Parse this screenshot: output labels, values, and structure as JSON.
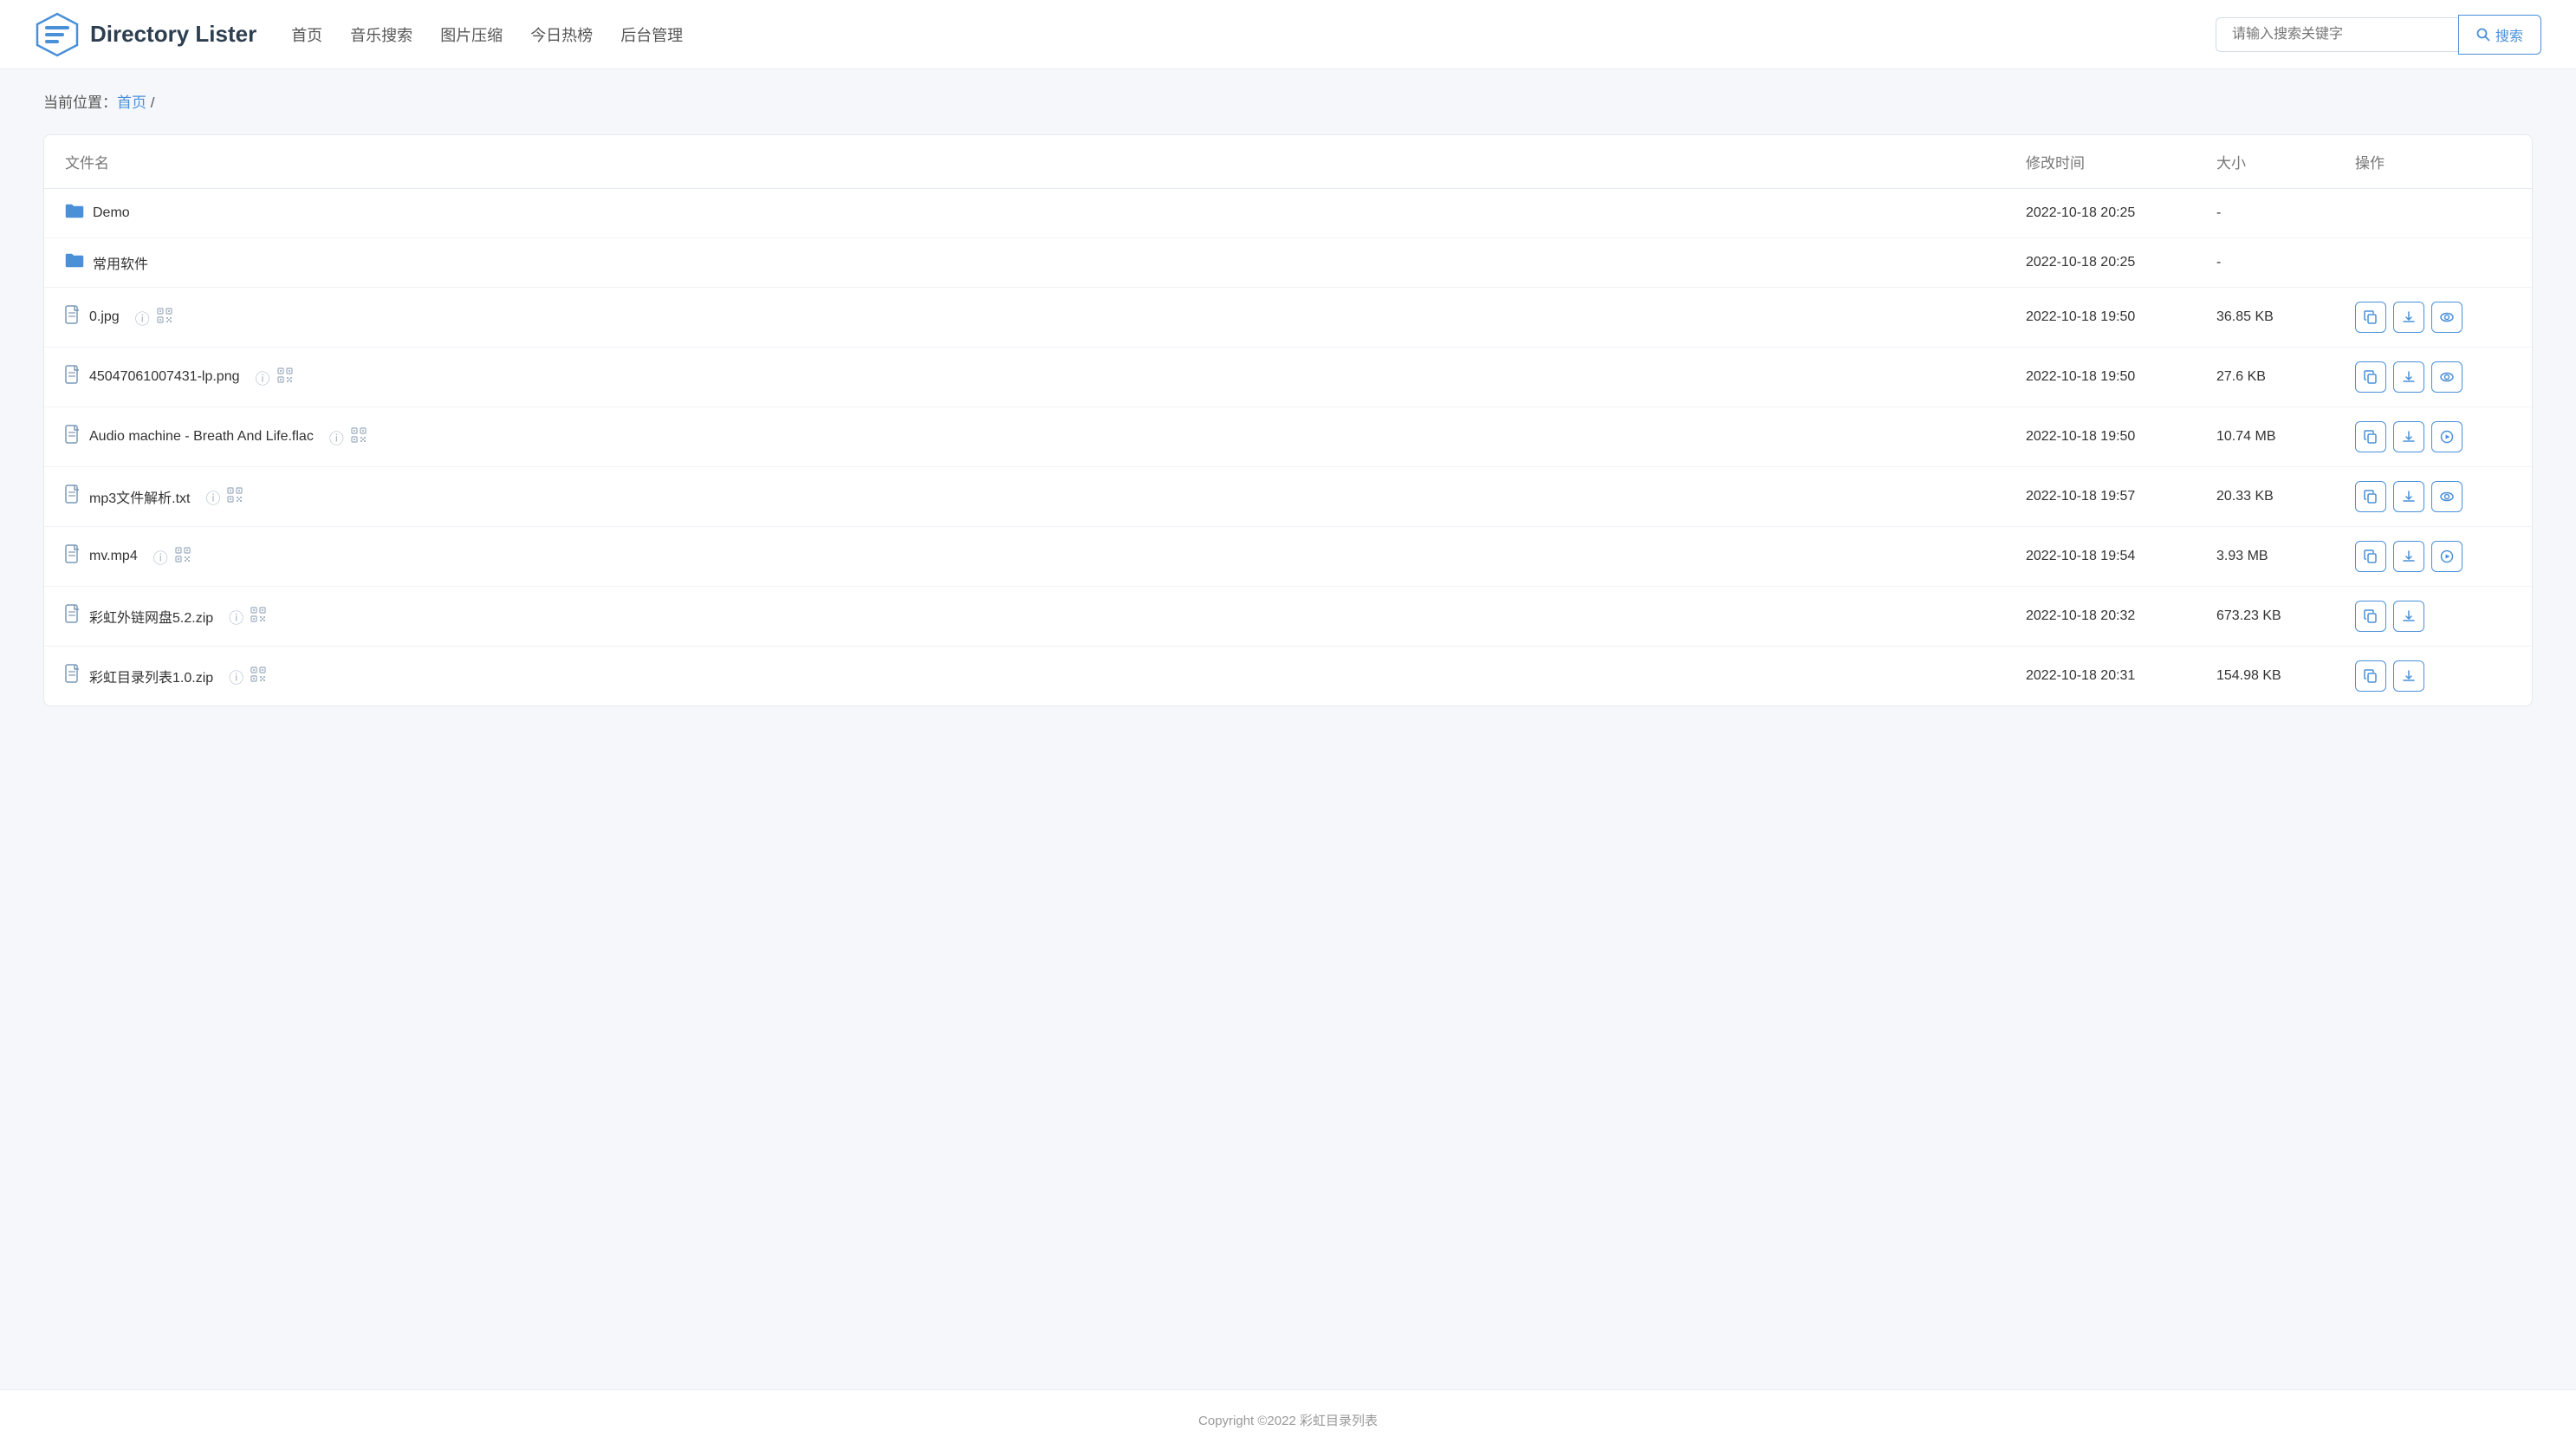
{
  "header": {
    "logo_text": "Directory Lister",
    "nav": [
      {
        "label": "首页",
        "id": "home"
      },
      {
        "label": "音乐搜索",
        "id": "music"
      },
      {
        "label": "图片压缩",
        "id": "image"
      },
      {
        "label": "今日热榜",
        "id": "hot"
      },
      {
        "label": "后台管理",
        "id": "admin"
      }
    ],
    "search_placeholder": "请输入搜索关键字",
    "search_button": "搜索"
  },
  "breadcrumb": {
    "prefix": "当前位置：",
    "home_link": "首页",
    "separator": " /"
  },
  "table": {
    "headers": {
      "filename": "文件名",
      "modified": "修改时间",
      "size": "大小",
      "actions": "操作"
    },
    "rows": [
      {
        "id": "row-demo",
        "type": "folder",
        "name": "Demo",
        "modified": "2022-10-18 20:25",
        "size": "-",
        "actions": []
      },
      {
        "id": "row-software",
        "type": "folder",
        "name": "常用软件",
        "modified": "2022-10-18 20:25",
        "size": "-",
        "actions": []
      },
      {
        "id": "row-0jpg",
        "type": "file",
        "name": "0.jpg",
        "modified": "2022-10-18 19:50",
        "size": "36.85 KB",
        "actions": [
          "copy",
          "download",
          "view"
        ]
      },
      {
        "id": "row-png",
        "type": "file",
        "name": "45047061007431-lp.png",
        "modified": "2022-10-18 19:50",
        "size": "27.6 KB",
        "actions": [
          "copy",
          "download",
          "view"
        ]
      },
      {
        "id": "row-flac",
        "type": "file",
        "name": "Audio machine - Breath And Life.flac",
        "modified": "2022-10-18 19:50",
        "size": "10.74 MB",
        "actions": [
          "copy",
          "download",
          "play"
        ]
      },
      {
        "id": "row-txt",
        "type": "file",
        "name": "mp3文件解析.txt",
        "modified": "2022-10-18 19:57",
        "size": "20.33 KB",
        "actions": [
          "copy",
          "download",
          "view"
        ]
      },
      {
        "id": "row-mp4",
        "type": "file",
        "name": "mv.mp4",
        "modified": "2022-10-18 19:54",
        "size": "3.93 MB",
        "actions": [
          "copy",
          "download",
          "play"
        ]
      },
      {
        "id": "row-zip1",
        "type": "file",
        "name": "彩虹外链网盘5.2.zip",
        "modified": "2022-10-18 20:32",
        "size": "673.23 KB",
        "actions": [
          "copy",
          "download"
        ]
      },
      {
        "id": "row-zip2",
        "type": "file",
        "name": "彩虹目录列表1.0.zip",
        "modified": "2022-10-18 20:31",
        "size": "154.98 KB",
        "actions": [
          "copy",
          "download"
        ]
      }
    ]
  },
  "footer": {
    "copyright": "Copyright ©2022 彩虹目录列表"
  }
}
